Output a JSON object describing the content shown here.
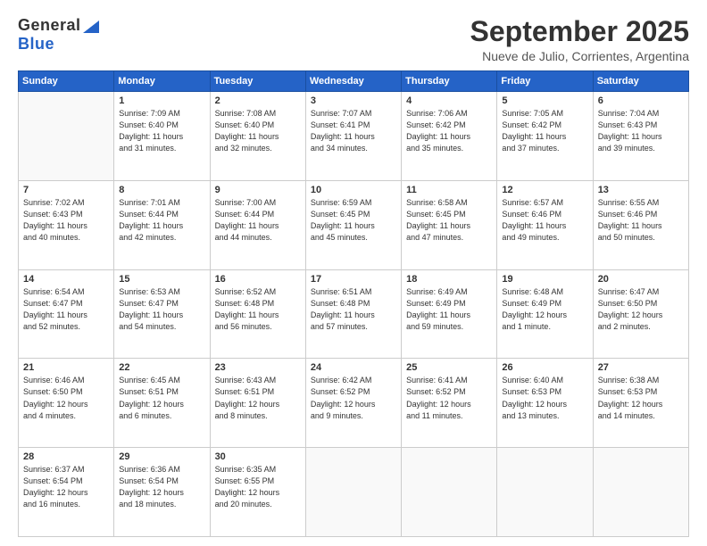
{
  "logo": {
    "general": "General",
    "blue": "Blue"
  },
  "title": "September 2025",
  "location": "Nueve de Julio, Corrientes, Argentina",
  "headers": [
    "Sunday",
    "Monday",
    "Tuesday",
    "Wednesday",
    "Thursday",
    "Friday",
    "Saturday"
  ],
  "weeks": [
    [
      {
        "day": "",
        "info": ""
      },
      {
        "day": "1",
        "info": "Sunrise: 7:09 AM\nSunset: 6:40 PM\nDaylight: 11 hours\nand 31 minutes."
      },
      {
        "day": "2",
        "info": "Sunrise: 7:08 AM\nSunset: 6:40 PM\nDaylight: 11 hours\nand 32 minutes."
      },
      {
        "day": "3",
        "info": "Sunrise: 7:07 AM\nSunset: 6:41 PM\nDaylight: 11 hours\nand 34 minutes."
      },
      {
        "day": "4",
        "info": "Sunrise: 7:06 AM\nSunset: 6:42 PM\nDaylight: 11 hours\nand 35 minutes."
      },
      {
        "day": "5",
        "info": "Sunrise: 7:05 AM\nSunset: 6:42 PM\nDaylight: 11 hours\nand 37 minutes."
      },
      {
        "day": "6",
        "info": "Sunrise: 7:04 AM\nSunset: 6:43 PM\nDaylight: 11 hours\nand 39 minutes."
      }
    ],
    [
      {
        "day": "7",
        "info": "Sunrise: 7:02 AM\nSunset: 6:43 PM\nDaylight: 11 hours\nand 40 minutes."
      },
      {
        "day": "8",
        "info": "Sunrise: 7:01 AM\nSunset: 6:44 PM\nDaylight: 11 hours\nand 42 minutes."
      },
      {
        "day": "9",
        "info": "Sunrise: 7:00 AM\nSunset: 6:44 PM\nDaylight: 11 hours\nand 44 minutes."
      },
      {
        "day": "10",
        "info": "Sunrise: 6:59 AM\nSunset: 6:45 PM\nDaylight: 11 hours\nand 45 minutes."
      },
      {
        "day": "11",
        "info": "Sunrise: 6:58 AM\nSunset: 6:45 PM\nDaylight: 11 hours\nand 47 minutes."
      },
      {
        "day": "12",
        "info": "Sunrise: 6:57 AM\nSunset: 6:46 PM\nDaylight: 11 hours\nand 49 minutes."
      },
      {
        "day": "13",
        "info": "Sunrise: 6:55 AM\nSunset: 6:46 PM\nDaylight: 11 hours\nand 50 minutes."
      }
    ],
    [
      {
        "day": "14",
        "info": "Sunrise: 6:54 AM\nSunset: 6:47 PM\nDaylight: 11 hours\nand 52 minutes."
      },
      {
        "day": "15",
        "info": "Sunrise: 6:53 AM\nSunset: 6:47 PM\nDaylight: 11 hours\nand 54 minutes."
      },
      {
        "day": "16",
        "info": "Sunrise: 6:52 AM\nSunset: 6:48 PM\nDaylight: 11 hours\nand 56 minutes."
      },
      {
        "day": "17",
        "info": "Sunrise: 6:51 AM\nSunset: 6:48 PM\nDaylight: 11 hours\nand 57 minutes."
      },
      {
        "day": "18",
        "info": "Sunrise: 6:49 AM\nSunset: 6:49 PM\nDaylight: 11 hours\nand 59 minutes."
      },
      {
        "day": "19",
        "info": "Sunrise: 6:48 AM\nSunset: 6:49 PM\nDaylight: 12 hours\nand 1 minute."
      },
      {
        "day": "20",
        "info": "Sunrise: 6:47 AM\nSunset: 6:50 PM\nDaylight: 12 hours\nand 2 minutes."
      }
    ],
    [
      {
        "day": "21",
        "info": "Sunrise: 6:46 AM\nSunset: 6:50 PM\nDaylight: 12 hours\nand 4 minutes."
      },
      {
        "day": "22",
        "info": "Sunrise: 6:45 AM\nSunset: 6:51 PM\nDaylight: 12 hours\nand 6 minutes."
      },
      {
        "day": "23",
        "info": "Sunrise: 6:43 AM\nSunset: 6:51 PM\nDaylight: 12 hours\nand 8 minutes."
      },
      {
        "day": "24",
        "info": "Sunrise: 6:42 AM\nSunset: 6:52 PM\nDaylight: 12 hours\nand 9 minutes."
      },
      {
        "day": "25",
        "info": "Sunrise: 6:41 AM\nSunset: 6:52 PM\nDaylight: 12 hours\nand 11 minutes."
      },
      {
        "day": "26",
        "info": "Sunrise: 6:40 AM\nSunset: 6:53 PM\nDaylight: 12 hours\nand 13 minutes."
      },
      {
        "day": "27",
        "info": "Sunrise: 6:38 AM\nSunset: 6:53 PM\nDaylight: 12 hours\nand 14 minutes."
      }
    ],
    [
      {
        "day": "28",
        "info": "Sunrise: 6:37 AM\nSunset: 6:54 PM\nDaylight: 12 hours\nand 16 minutes."
      },
      {
        "day": "29",
        "info": "Sunrise: 6:36 AM\nSunset: 6:54 PM\nDaylight: 12 hours\nand 18 minutes."
      },
      {
        "day": "30",
        "info": "Sunrise: 6:35 AM\nSunset: 6:55 PM\nDaylight: 12 hours\nand 20 minutes."
      },
      {
        "day": "",
        "info": ""
      },
      {
        "day": "",
        "info": ""
      },
      {
        "day": "",
        "info": ""
      },
      {
        "day": "",
        "info": ""
      }
    ]
  ]
}
